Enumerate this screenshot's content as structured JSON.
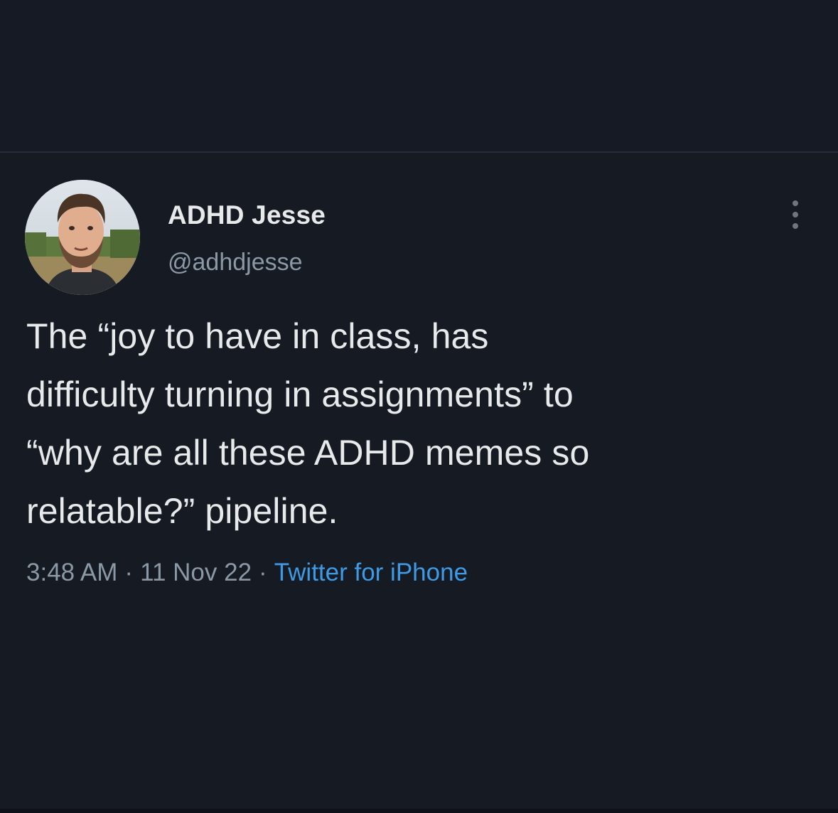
{
  "tweet": {
    "author": {
      "display_name": "ADHD Jesse",
      "handle": "@adhdjesse",
      "avatar_icon": "profile-photo"
    },
    "more_icon": "vertical-ellipsis-icon",
    "text_lines": [
      "The “joy to have in class, has",
      "difficulty turning in assignments” to",
      "“why are all these ADHD memes so",
      "relatable?” pipeline."
    ],
    "meta": {
      "time": "3:48 AM",
      "separator": "·",
      "date": "11 Nov 22",
      "source": "Twitter for iPhone"
    }
  },
  "colors": {
    "background": "#151a23",
    "primary_text": "#e7e9ea",
    "secondary_text": "#8b98a5",
    "link": "#3f9ae6",
    "divider": "#262d38"
  }
}
